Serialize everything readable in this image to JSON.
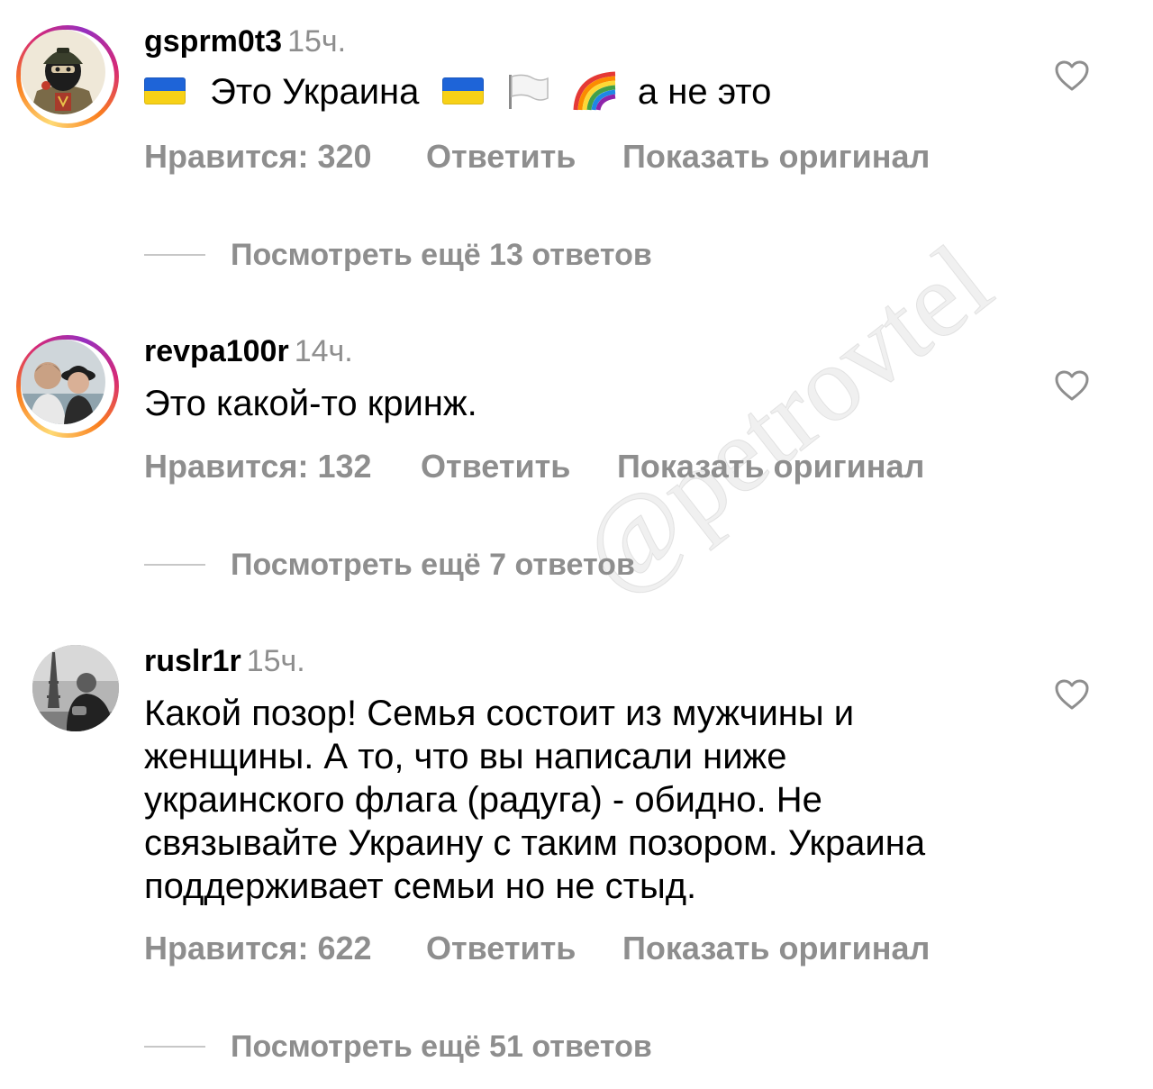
{
  "comments": [
    {
      "username": "gsprm0t3",
      "time": "15ч.",
      "text_part1": "Это Украина",
      "text_part2": "а не это",
      "likes": "Нравится: 320",
      "reply": "Ответить",
      "show_original": "Показать оригинал",
      "view_more": "Посмотреть ещё 13 ответов",
      "avatar_icon": "soldier-avatar",
      "heart_icon": "heart-outline-icon"
    },
    {
      "username": "revpa100r",
      "time": "14ч.",
      "text": "Это какой-то кринж.",
      "likes": "Нравится: 132",
      "reply": "Ответить",
      "show_original": "Показать оригинал",
      "view_more": "Посмотреть ещё 7 ответов",
      "avatar_icon": "couple-photo-avatar",
      "heart_icon": "heart-outline-icon"
    },
    {
      "username": "ruslr1r",
      "time": "15ч.",
      "text": "Какой позор! Семья состоит из мужчины и женщины. А то, что вы написали ниже украинского флага (радуга) - обидно. Не связывайте Украину с таким позором. Украина поддерживает семьи но не стыд.",
      "likes": "Нравится: 622",
      "reply": "Ответить",
      "show_original": "Показать оригинал",
      "view_more": "Посмотреть ещё 51 ответов",
      "avatar_icon": "man-with-eiffel-tower-avatar",
      "heart_icon": "heart-outline-icon"
    }
  ],
  "watermark": "@petrovtel",
  "colors": {
    "text": "#000000",
    "secondary": "#8e8e8e",
    "divider": "#c7c7c7",
    "flag_blue": "#1e64d8",
    "flag_yellow": "#f7d117"
  }
}
